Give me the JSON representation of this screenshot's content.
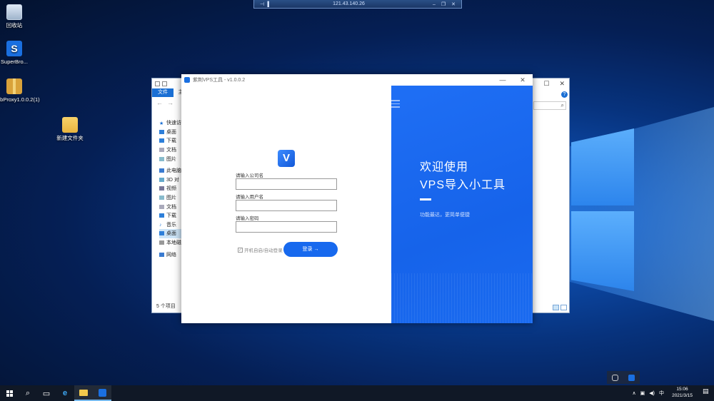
{
  "rdp_bar": {
    "title": "121.43.140.26"
  },
  "desktop_icons": [
    {
      "label": "回收站"
    },
    {
      "label": "SuperBro..."
    },
    {
      "label": "5bProxy1.0.0.2(1)"
    },
    {
      "label": "新建文件夹"
    }
  ],
  "explorer": {
    "ribbon_file": "文件",
    "ribbon_home": "主",
    "sidebar": [
      "快速访",
      "桌面",
      "下载",
      "文档",
      "图片",
      "此电脑",
      "3D 对",
      "视频",
      "图片",
      "文档",
      "下载",
      "音乐",
      "桌面",
      "本地磁",
      "网络"
    ],
    "status": "5 个项目"
  },
  "app": {
    "title": "紫荆VPS工具 - v1.0.0.2",
    "window_controls": [
      "—",
      "✕"
    ],
    "icon_glyph": "V",
    "label_company": "请输入公司名",
    "label_user": "请输入用户名",
    "label_password": "请输入密码",
    "auto_login": "开机自启/自动登录",
    "login_button": "登录 →",
    "welcome_line1": "欢迎使用",
    "welcome_line2": "VPS导入小工具",
    "welcome_sub": "功能最达，更简单便捷",
    "brand_color": "#1769ee"
  },
  "taskbar": {
    "time": "15:06",
    "date": "2021/3/15",
    "tray_lang": "中"
  }
}
